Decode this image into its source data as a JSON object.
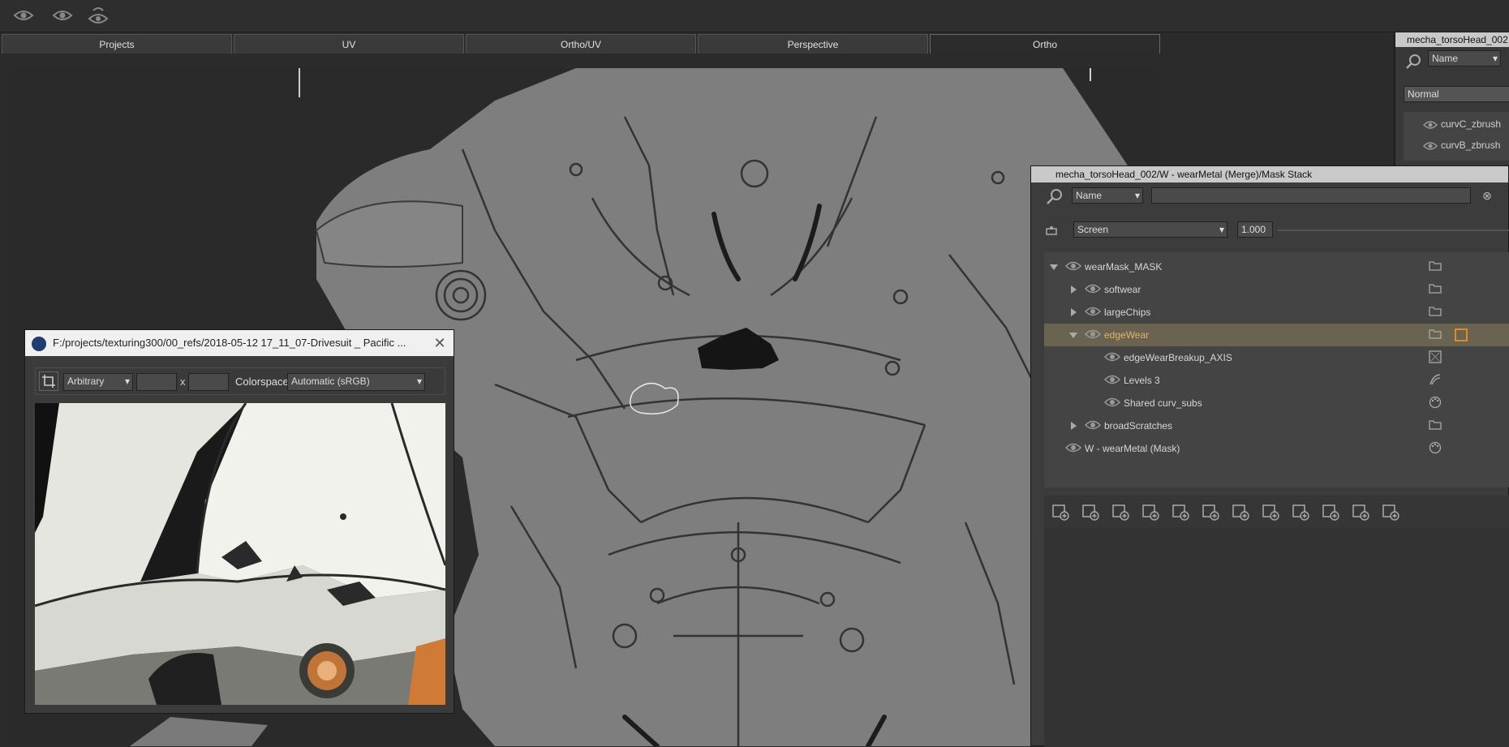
{
  "toolbar": {
    "icons": [
      "eye-icon",
      "eye-icon",
      "eye-cluster-icon"
    ]
  },
  "tabs": [
    {
      "label": "Projects",
      "active": false
    },
    {
      "label": "UV",
      "active": false
    },
    {
      "label": "Ortho/UV",
      "active": false
    },
    {
      "label": "Perspective",
      "active": false
    },
    {
      "label": "Ortho",
      "active": true
    }
  ],
  "right_panel": {
    "title": "mecha_torsoHead_002",
    "filter_select": "Name",
    "blend_select": "Normal",
    "layers": [
      "curvC_zbrush",
      "curvB_zbrush"
    ]
  },
  "mask_stack": {
    "title": "mecha_torsoHead_002/W - wearMetal (Merge)/Mask Stack",
    "filter_select": "Name",
    "search_value": "",
    "blend_mode": "Screen",
    "opacity": "1.000",
    "tree": [
      {
        "label": "wearMask_MASK",
        "level": 0,
        "expand": "open",
        "icon": "folder-icon",
        "selected": false
      },
      {
        "label": "softwear",
        "level": 1,
        "expand": "closed",
        "icon": "folder-icon",
        "selected": false
      },
      {
        "label": "largeChips",
        "level": 1,
        "expand": "closed",
        "icon": "folder-icon",
        "selected": false
      },
      {
        "label": "edgeWear",
        "level": 1,
        "expand": "open",
        "icon": "folder-icon",
        "selected": true
      },
      {
        "label": "edgeWearBreakup_AXIS",
        "level": 2,
        "expand": "none",
        "icon": "texture-icon",
        "selected": false
      },
      {
        "label": "Levels 3",
        "level": 2,
        "expand": "none",
        "icon": "levels-icon",
        "selected": false
      },
      {
        "label": "Shared curv_subs",
        "level": 2,
        "expand": "none",
        "icon": "palette-icon",
        "selected": false
      },
      {
        "label": "broadScratches",
        "level": 1,
        "expand": "closed",
        "icon": "folder-icon",
        "selected": false
      },
      {
        "label": "W - wearMetal (Mask)",
        "level": 0,
        "expand": "none",
        "icon": "palette-icon",
        "selected": false
      }
    ],
    "buttons": [
      "add-paint-layer",
      "add-adjustment-layer",
      "add-procedural-layer",
      "add-shared-layer",
      "add-levels-layer",
      "add-texture-layer",
      "add-group-layer",
      "add-folder-layer",
      "remove-layer",
      "layer-list",
      "delete-layer",
      "grid-view"
    ]
  },
  "reference_window": {
    "title": "F:/projects/texturing300/00_refs/2018-05-12 17_11_07-Drivesuit _ Pacific ...",
    "crop_mode": "Arbitrary",
    "width_value": "",
    "x_label": "x",
    "height_value": "",
    "colorspace_label": "Colorspace",
    "colorspace_value": "Automatic (sRGB)"
  },
  "colors": {
    "bg": "#2b2b2b",
    "viewport_model": "#7e7e7e",
    "selection_row": "#6a6352",
    "selection_text": "#e3b46a",
    "accent_orange": "#e08a2a"
  }
}
